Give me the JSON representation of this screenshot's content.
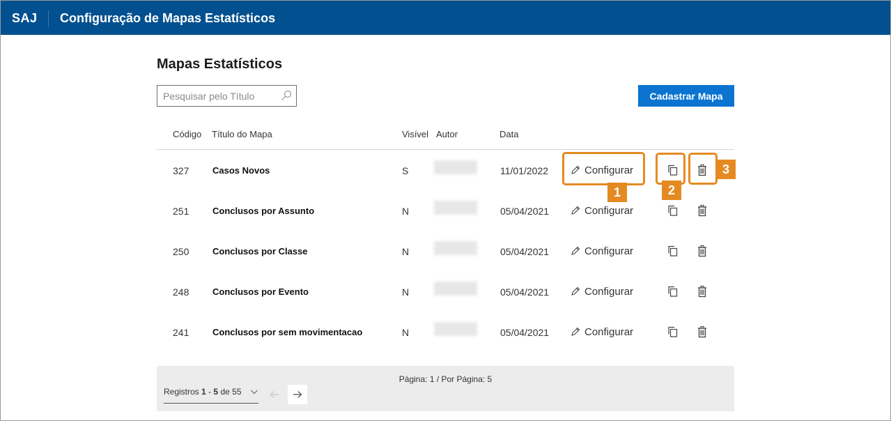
{
  "header": {
    "logo": "SAJ",
    "title": "Configuração de Mapas Estatísticos"
  },
  "page": {
    "title": "Mapas Estatísticos"
  },
  "search": {
    "placeholder": "Pesquisar pelo Título",
    "value": ""
  },
  "toolbar": {
    "add_label": "Cadastrar Mapa"
  },
  "table": {
    "columns": [
      "Código",
      "Título do Mapa",
      "Visível",
      "Autor",
      "Data"
    ],
    "configure_label": "Configurar",
    "rows": [
      {
        "code": "327",
        "title": "Casos Novos",
        "visible": "S",
        "date": "11/01/2022"
      },
      {
        "code": "251",
        "title": "Conclusos por Assunto",
        "visible": "N",
        "date": "05/04/2021"
      },
      {
        "code": "250",
        "title": "Conclusos por Classe",
        "visible": "N",
        "date": "05/04/2021"
      },
      {
        "code": "248",
        "title": "Conclusos por Evento",
        "visible": "N",
        "date": "05/04/2021"
      },
      {
        "code": "241",
        "title": "Conclusos por sem movimentacao",
        "visible": "N",
        "date": "05/04/2021"
      }
    ]
  },
  "callouts": [
    "1",
    "2",
    "3"
  ],
  "pagination": {
    "info": "Página: 1 / Por Página: 5",
    "registros_label": "Registros",
    "range_start": "1",
    "range_sep": "-",
    "range_end": "5",
    "of_label": "de",
    "total": "55"
  },
  "icons": {
    "search": "search-icon",
    "edit": "pencil-icon",
    "copy": "copy-icon",
    "delete": "trash-icon",
    "prev": "arrow-left-icon",
    "next": "arrow-right-icon",
    "dropdown": "chevron-down-icon"
  },
  "colors": {
    "header": "#02508f",
    "primary": "#0a74d0",
    "callout": "#e58a22"
  }
}
